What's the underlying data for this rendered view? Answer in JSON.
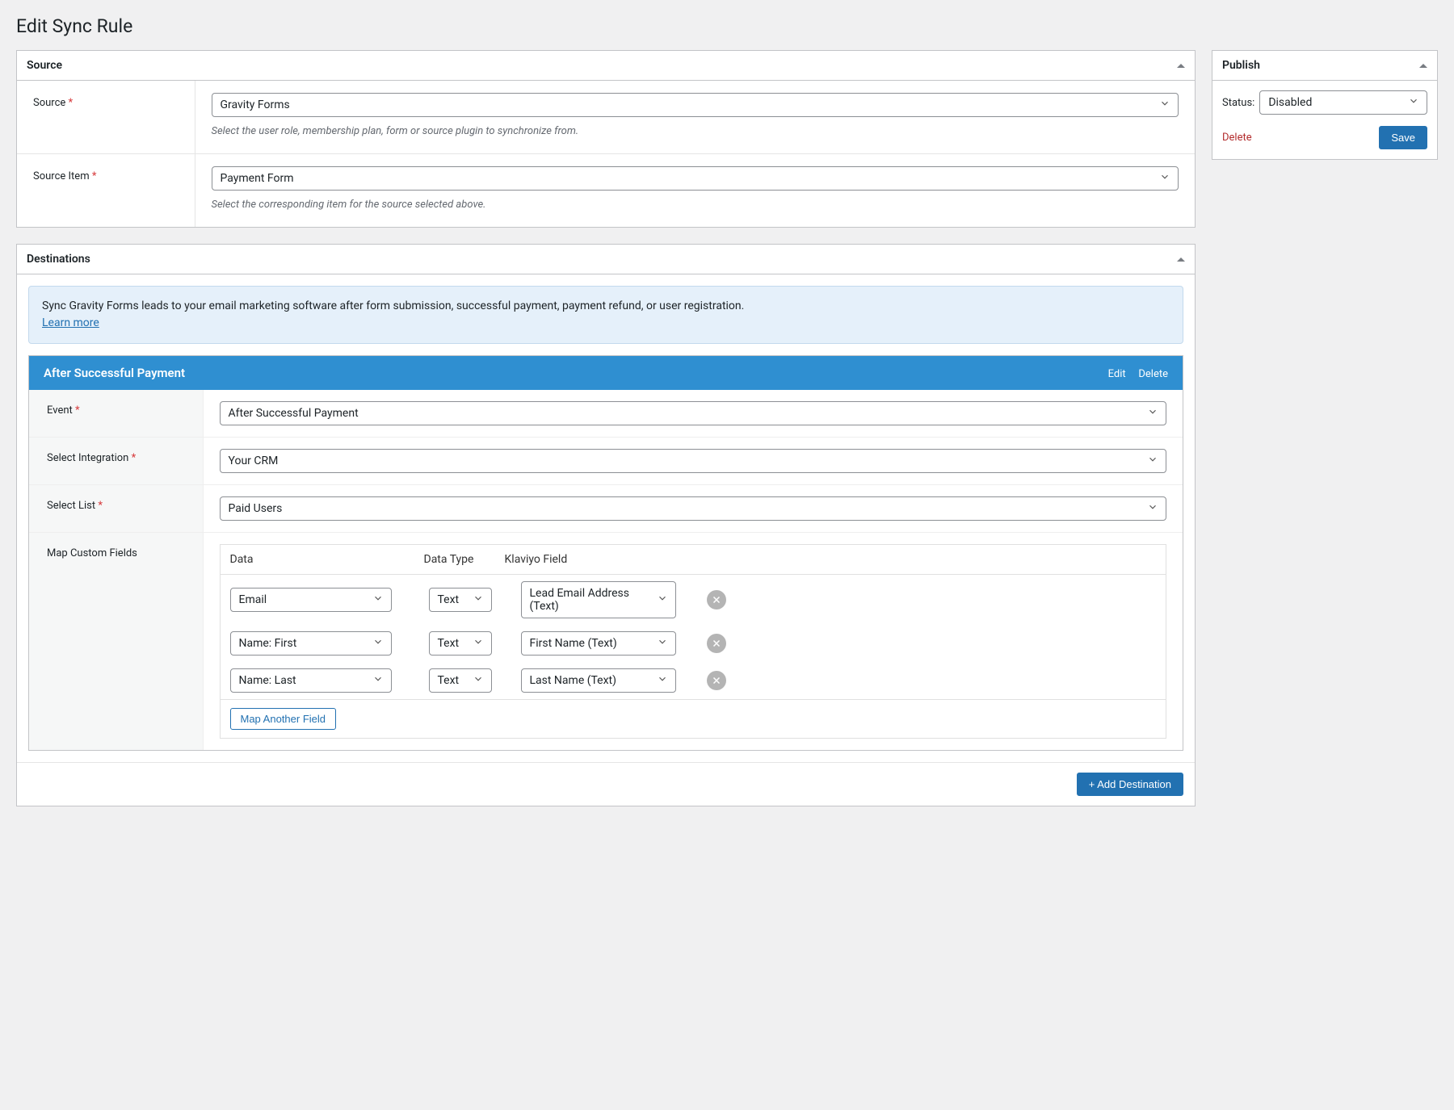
{
  "page": {
    "title": "Edit Sync Rule"
  },
  "source_panel": {
    "title": "Source",
    "fields": {
      "source": {
        "label": "Source",
        "value": "Gravity Forms",
        "help": "Select the user role, membership plan, form or source plugin to synchronize from."
      },
      "source_item": {
        "label": "Source Item",
        "value": "Payment Form",
        "help": "Select the corresponding item for the source selected above."
      }
    }
  },
  "destinations_panel": {
    "title": "Destinations",
    "notice": {
      "text": "Sync Gravity Forms leads to your email marketing software after form submission, successful payment, payment refund, or user registration.",
      "link_label": "Learn more"
    },
    "block": {
      "title": "After Successful Payment",
      "edit": "Edit",
      "delete": "Delete",
      "event": {
        "label": "Event",
        "value": "After Successful Payment"
      },
      "integration": {
        "label": "Select Integration",
        "value": "Your CRM"
      },
      "list": {
        "label": "Select List",
        "value": "Paid Users"
      },
      "map": {
        "label": "Map Custom Fields",
        "headers": {
          "data": "Data",
          "data_type": "Data Type",
          "target": "Klaviyo Field"
        },
        "rows": [
          {
            "data": "Email",
            "type": "Text",
            "target": "Lead Email Address (Text)"
          },
          {
            "data": "Name: First",
            "type": "Text",
            "target": "First Name (Text)"
          },
          {
            "data": "Name: Last",
            "type": "Text",
            "target": "Last Name (Text)"
          }
        ],
        "add_label": "Map Another Field"
      }
    },
    "add_destination": "+ Add Destination"
  },
  "publish_panel": {
    "title": "Publish",
    "status_label": "Status:",
    "status_value": "Disabled",
    "delete": "Delete",
    "save": "Save"
  }
}
